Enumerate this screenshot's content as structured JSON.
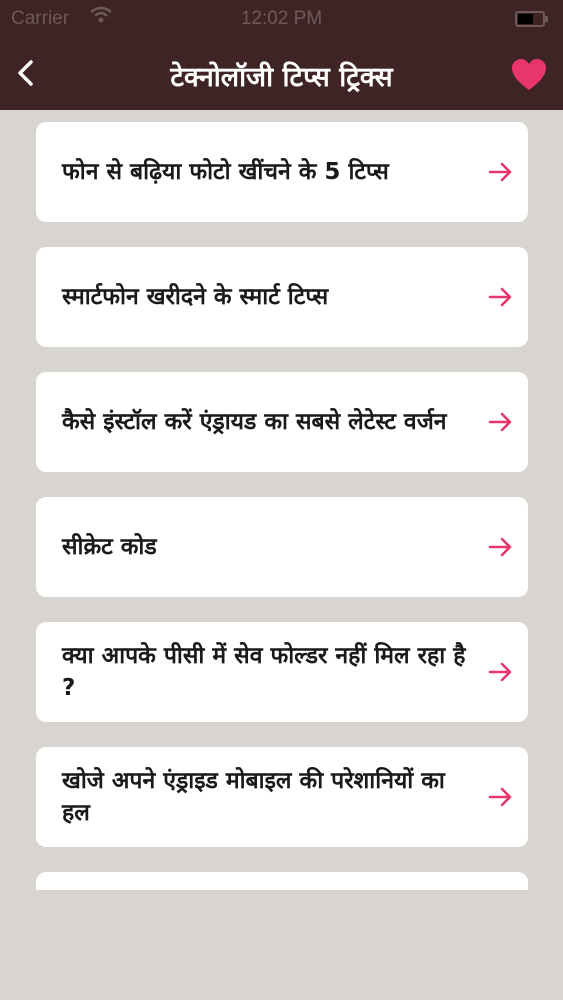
{
  "status_bar": {
    "carrier": "Carrier",
    "time": "12:02 PM"
  },
  "nav": {
    "title": "टेक्नोलॉजी टिप्स ट्रिक्स",
    "back_icon": "chevron-left-icon",
    "favorite_icon": "heart-icon"
  },
  "list": {
    "items": [
      {
        "label": "फोन से बढ़िया फोटो खींचने के 5 टिप्स"
      },
      {
        "label": "स्मार्टफोन खरीदने के स्मार्ट टिप्स"
      },
      {
        "label": "कैसे इंस्टॉल करें एंड्रायड का सबसे लेटेस्ट वर्जन"
      },
      {
        "label": "सीक्रेट कोड"
      },
      {
        "label": "क्या आपके पीसी में सेव फोल्डर नहीं मिल रहा है ?"
      },
      {
        "label": "खोजे अपने एंड्राइड मोबाइल की परेशानियों का हल"
      }
    ],
    "arrow_icon": "arrow-right-icon"
  },
  "colors": {
    "header_bg": "#3e2424",
    "page_bg": "#d8d4cf",
    "accent": "#e8356b"
  }
}
